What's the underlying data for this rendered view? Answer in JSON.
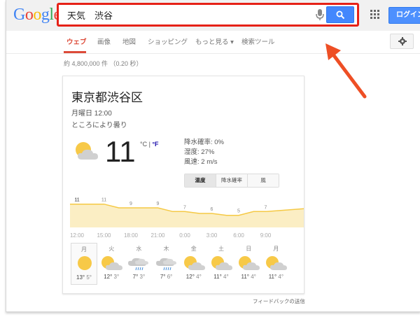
{
  "logo": "Google",
  "search": {
    "value": "天気　渋谷"
  },
  "header": {
    "login_label": "ログイン"
  },
  "nav": {
    "items": [
      "ウェブ",
      "画像",
      "地図",
      "ショッピング",
      "もっと見る ▾",
      "検索ツール"
    ]
  },
  "result_stats": "約 4,800,000 件 （0.20 秒）",
  "weather": {
    "location": "東京都渋谷区",
    "time": "月曜日 12:00",
    "condition": "ところにより曇り",
    "temperature": "11",
    "unit_c": "°C",
    "unit_sep": " | ",
    "unit_f": "°F",
    "details": [
      "降水確率: 0%",
      "湿度: 27%",
      "風速: 2 m/s"
    ],
    "tabs": [
      "温度",
      "降水確率",
      "風"
    ]
  },
  "chart_data": {
    "type": "area",
    "x": [
      "12:00",
      "15:00",
      "18:00",
      "21:00",
      "0:00",
      "3:00",
      "6:00",
      "9:00"
    ],
    "series": [
      {
        "values": [
          11,
          11,
          9,
          9,
          7,
          6,
          5,
          7
        ]
      }
    ],
    "color": "#f5c945"
  },
  "forecast": [
    {
      "day": "月",
      "high": "13°",
      "low": "5°",
      "icon": "sunny"
    },
    {
      "day": "火",
      "high": "12°",
      "low": "3°",
      "icon": "partly-cloudy"
    },
    {
      "day": "水",
      "high": "7°",
      "low": "3°",
      "icon": "rain"
    },
    {
      "day": "木",
      "high": "7°",
      "low": "6°",
      "icon": "rain"
    },
    {
      "day": "金",
      "high": "12°",
      "low": "4°",
      "icon": "partly-cloudy"
    },
    {
      "day": "土",
      "high": "11°",
      "low": "4°",
      "icon": "partly-cloudy"
    },
    {
      "day": "日",
      "high": "11°",
      "low": "4°",
      "icon": "partly-cloudy"
    },
    {
      "day": "月",
      "high": "11°",
      "low": "4°",
      "icon": "partly-cloudy"
    }
  ],
  "feedback": "フィードバックの送信"
}
